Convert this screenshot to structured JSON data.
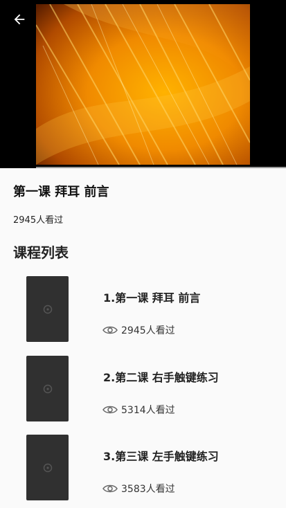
{
  "header": {
    "back_icon": "arrow-left-icon"
  },
  "video": {
    "poster": "orange-light-streaks"
  },
  "current_lesson": {
    "title": "第一课 拜耳 前言",
    "views": "2945人看过"
  },
  "course_list": {
    "heading": "课程列表",
    "items": [
      {
        "title": "1.第一课 拜耳 前言",
        "views": "2945人看过"
      },
      {
        "title": "2.第二课 右手触键练习",
        "views": "5314人看过"
      },
      {
        "title": "3.第三课 左手触键练习",
        "views": "3583人看过"
      }
    ]
  },
  "colors": {
    "background": "#fafafa",
    "video_bg": "#000000",
    "thumb_bg": "#303030"
  }
}
